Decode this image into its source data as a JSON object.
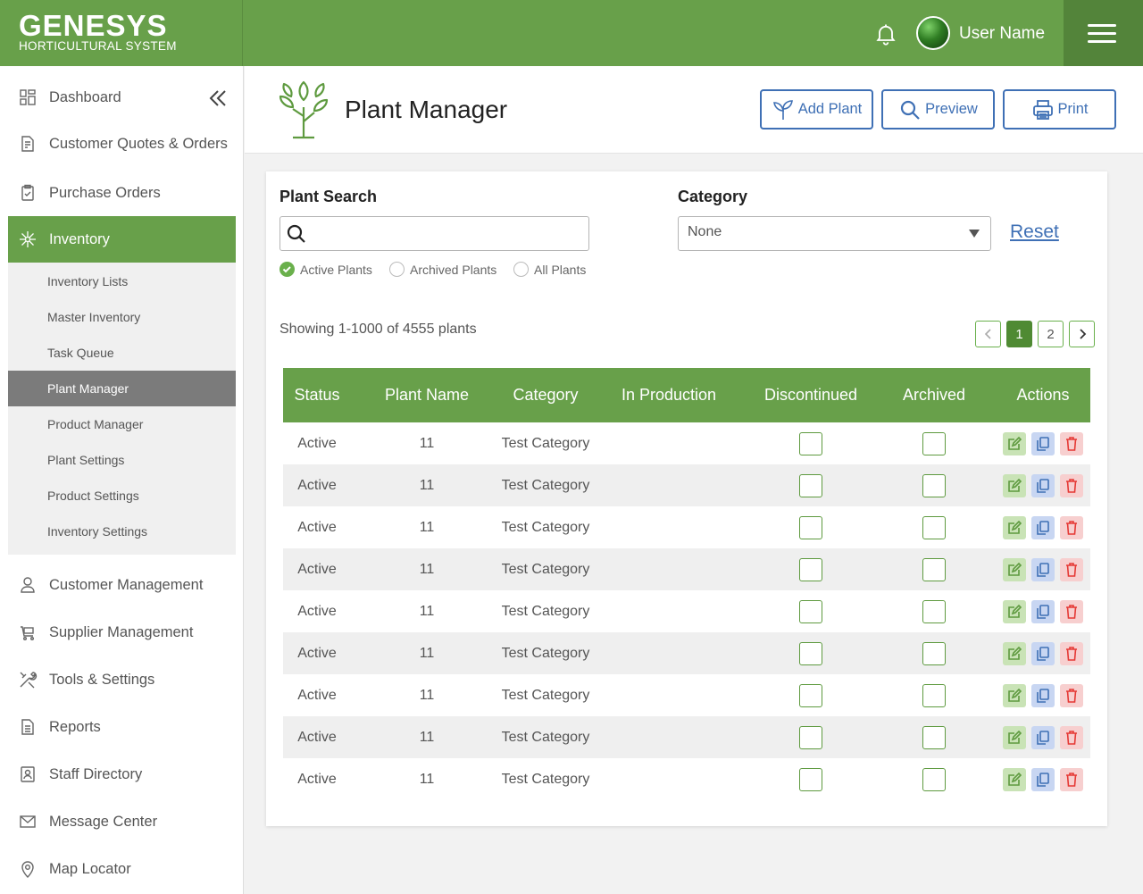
{
  "brand": {
    "name": "GENESYS",
    "subtitle": "HORTICULTURAL SYSTEM"
  },
  "topbar": {
    "user_name": "User Name",
    "icons": [
      "bell-icon",
      "avatar",
      "hamburger-menu-icon"
    ]
  },
  "sidebar": {
    "items": [
      {
        "label": "Dashboard",
        "icon": "dashboard-icon"
      },
      {
        "label": "Customer Quotes & Orders",
        "icon": "document-icon"
      },
      {
        "label": "Purchase Orders",
        "icon": "clipboard-icon"
      },
      {
        "label": "Inventory",
        "icon": "plant-icon",
        "active": true
      },
      {
        "label": "Customer Management",
        "icon": "user-icon"
      },
      {
        "label": "Supplier Management",
        "icon": "cart-icon"
      },
      {
        "label": "Tools & Settings",
        "icon": "tools-icon"
      },
      {
        "label": "Reports",
        "icon": "report-icon"
      },
      {
        "label": "Staff Directory",
        "icon": "contact-icon"
      },
      {
        "label": "Message Center",
        "icon": "mail-icon"
      },
      {
        "label": "Map Locator",
        "icon": "map-pin-icon"
      }
    ],
    "subitems": [
      {
        "label": "Inventory Lists"
      },
      {
        "label": "Master Inventory"
      },
      {
        "label": "Task Queue"
      },
      {
        "label": "Plant Manager",
        "active": true
      },
      {
        "label": "Product Manager"
      },
      {
        "label": "Plant Settings"
      },
      {
        "label": "Product Settings"
      },
      {
        "label": "Inventory Settings"
      }
    ]
  },
  "header": {
    "title": "Plant Manager",
    "buttons": [
      {
        "label": "Add Plant",
        "icon": "sprout-icon"
      },
      {
        "label": "Preview",
        "icon": "search-icon"
      },
      {
        "label": "Print",
        "icon": "printer-icon"
      }
    ]
  },
  "filters": {
    "search_label": "Plant Search",
    "search_value": "",
    "radios": [
      {
        "label": "Active Plants",
        "checked": true
      },
      {
        "label": "Archived Plants",
        "checked": false
      },
      {
        "label": "All Plants",
        "checked": false
      }
    ],
    "category_label": "Category",
    "category_value": "None",
    "reset_label": "Reset"
  },
  "results": {
    "showing": "Showing 1-1000 of 4555 plants",
    "pages": [
      "1",
      "2"
    ],
    "current_page": "1"
  },
  "table": {
    "columns": [
      "Status",
      "Plant Name",
      "Category",
      "In Production",
      "Discontinued",
      "Archived",
      "Actions"
    ],
    "rows": [
      {
        "status": "Active",
        "name": "11",
        "category": "Test Category",
        "in_production": "",
        "discontinued": false,
        "archived": false
      },
      {
        "status": "Active",
        "name": "11",
        "category": "Test Category",
        "in_production": "",
        "discontinued": false,
        "archived": false
      },
      {
        "status": "Active",
        "name": "11",
        "category": "Test Category",
        "in_production": "",
        "discontinued": false,
        "archived": false
      },
      {
        "status": "Active",
        "name": "11",
        "category": "Test Category",
        "in_production": "",
        "discontinued": false,
        "archived": false
      },
      {
        "status": "Active",
        "name": "11",
        "category": "Test Category",
        "in_production": "",
        "discontinued": false,
        "archived": false
      },
      {
        "status": "Active",
        "name": "11",
        "category": "Test Category",
        "in_production": "",
        "discontinued": false,
        "archived": false
      },
      {
        "status": "Active",
        "name": "11",
        "category": "Test Category",
        "in_production": "",
        "discontinued": false,
        "archived": false
      },
      {
        "status": "Active",
        "name": "11",
        "category": "Test Category",
        "in_production": "",
        "discontinued": false,
        "archived": false
      },
      {
        "status": "Active",
        "name": "11",
        "category": "Test Category",
        "in_production": "",
        "discontinued": false,
        "archived": false
      }
    ]
  },
  "colors": {
    "brand_green": "#68a04a",
    "dark_green": "#53843a",
    "link_blue": "#3f70b5",
    "edit_green": "#c9e3b6",
    "copy_blue": "#c8d6f2",
    "delete_red": "#f7cfcf"
  }
}
